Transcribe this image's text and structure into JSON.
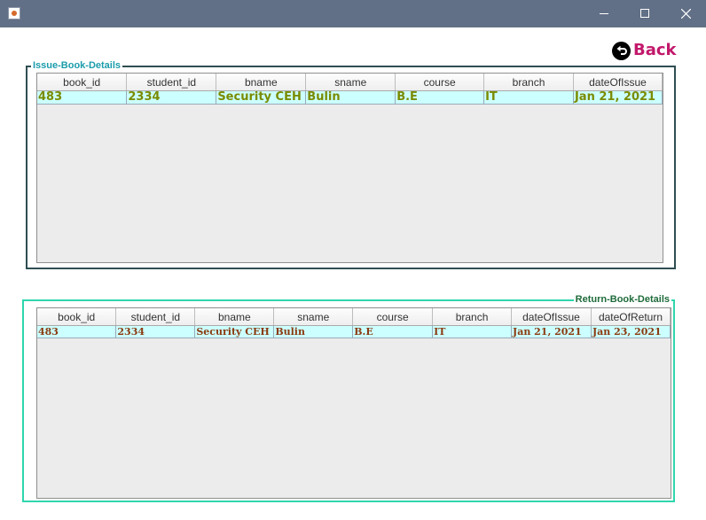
{
  "window": {
    "icons": {
      "app": "java-cup-icon",
      "minimize": "minimize-icon",
      "maximize": "maximize-icon",
      "close": "close-icon"
    }
  },
  "back_button": {
    "label": "Back",
    "icon": "back-arrow-icon",
    "color": "#c2186b"
  },
  "issue_panel": {
    "title": "Issue-Book-Details",
    "title_color": "#1a9cab",
    "border_color": "#2e4e52",
    "columns": [
      "book_id",
      "student_id",
      "bname",
      "sname",
      "course",
      "branch",
      "dateOfIssue"
    ],
    "rows": [
      [
        "483",
        "2334",
        "Security CEH",
        "Bulin",
        "B.E",
        "IT",
        "Jan 21, 2021"
      ]
    ],
    "text_color": "#7a8b00",
    "row_background": "#ccffff"
  },
  "return_panel": {
    "title": "Return-Book-Details",
    "title_color": "#1e6b3a",
    "border_color": "#2fd6ad",
    "columns": [
      "book_id",
      "student_id",
      "bname",
      "sname",
      "course",
      "branch",
      "dateOfIssue",
      "dateOfReturn"
    ],
    "rows": [
      [
        "483",
        "2334",
        "Security CEH",
        "Bulin",
        "B.E",
        "IT",
        "Jan 21, 2021",
        "Jan 23, 2021"
      ]
    ],
    "text_color": "#8b3a10",
    "row_background": "#ccffff"
  }
}
